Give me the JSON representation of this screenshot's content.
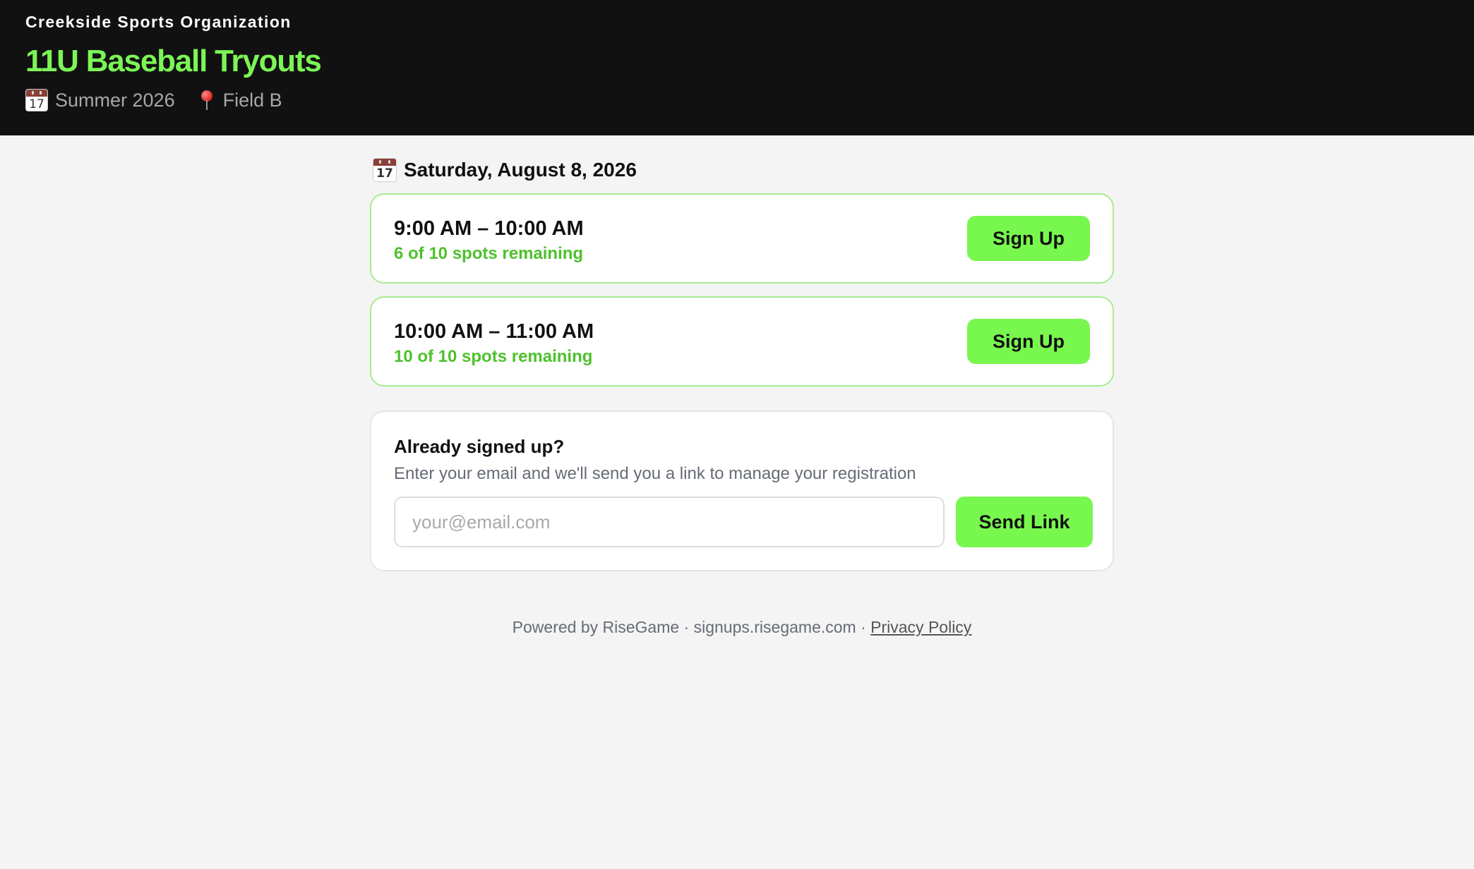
{
  "header": {
    "org_name": "Creekside Sports Organization",
    "title": "11U Baseball Tryouts",
    "season_icon": "calendar-icon",
    "season_icon_day": "17",
    "season": "Summer 2026",
    "location_icon": "map-pin-icon",
    "location": "Field B"
  },
  "schedule": {
    "date_icon": "calendar-icon",
    "date_icon_day": "17",
    "date": "Saturday, August 8, 2026",
    "slots": [
      {
        "time": "9:00 AM – 10:00 AM",
        "spots": "6 of 10 spots remaining",
        "button": "Sign Up"
      },
      {
        "time": "10:00 AM – 11:00 AM",
        "spots": "10 of 10 spots remaining",
        "button": "Sign Up"
      }
    ]
  },
  "manage": {
    "title": "Already signed up?",
    "description": "Enter your email and we'll send you a link to manage your registration",
    "email_value": "",
    "email_placeholder": "your@email.com",
    "button": "Send Link"
  },
  "footer": {
    "text": "Powered by RiseGame · signups.risegame.com · ",
    "privacy_link": "Privacy Policy"
  },
  "colors": {
    "header_bg": "#111111",
    "accent_green": "#78f74e",
    "title_green": "#7cf556",
    "spots_green": "#4ec12d",
    "slot_border": "#a7ec8f",
    "page_bg": "#f4f4f4"
  }
}
